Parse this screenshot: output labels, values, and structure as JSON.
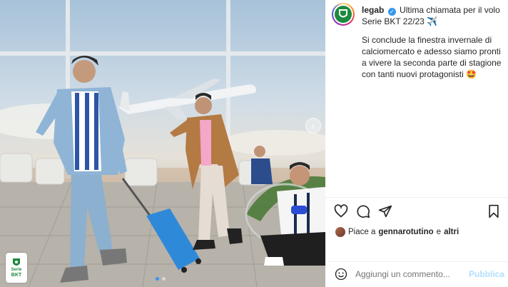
{
  "post": {
    "username": "legab",
    "caption_title": "Ultima chiamata per il volo Serie BKT 22/23",
    "caption_emoji": "✈️",
    "body": "Si conclude la finestra invernale di calciomercato e adesso siamo pronti a vivere la seconda parte di stagione con tanti nuovi protagonisti 🤩",
    "liked_prefix": "Piace a",
    "liked_user": "gennarotutino",
    "liked_and": "e",
    "liked_others": "altri",
    "comment_placeholder": "Aggiungi un commento...",
    "publish_label": "Pubblica"
  },
  "media": {
    "badge_line1": "Serie",
    "badge_line2": "BKT",
    "carousel_count": 2,
    "carousel_active": 1
  },
  "icons": {
    "like": "heart-icon",
    "comment": "comment-icon",
    "share": "send-icon",
    "save": "bookmark-icon",
    "emoji": "emoji-icon",
    "next": "chevron-right-icon",
    "verified": "verified-badge-icon"
  },
  "colors": {
    "accent": "#3897f0",
    "publish_disabled": "#b2dffc",
    "brand_green": "#1d8a3e"
  }
}
